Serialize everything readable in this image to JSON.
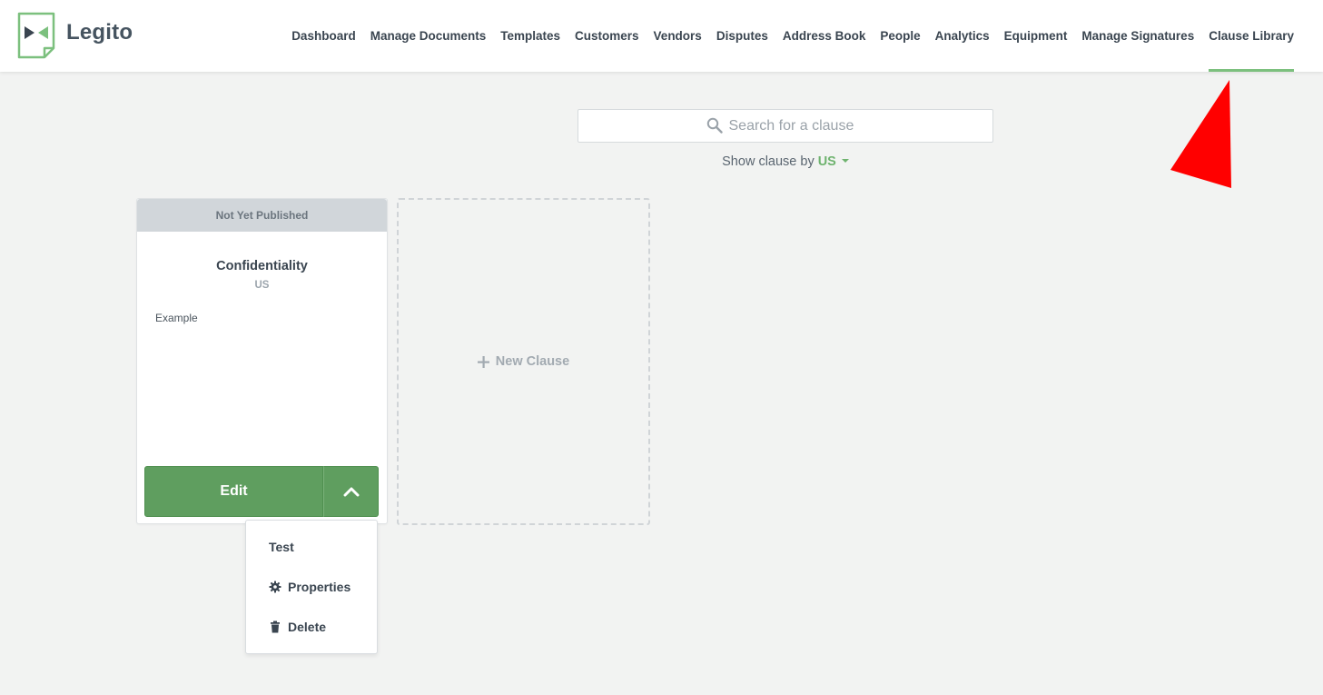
{
  "app": {
    "brand": "Legito",
    "logo_icon": "legito-logo-icon",
    "accent_color": "#7cc07e"
  },
  "nav": {
    "items": [
      {
        "label": "Dashboard"
      },
      {
        "label": "Manage Documents"
      },
      {
        "label": "Templates"
      },
      {
        "label": "Customers"
      },
      {
        "label": "Vendors"
      },
      {
        "label": "Disputes"
      },
      {
        "label": "Address Book"
      },
      {
        "label": "People"
      },
      {
        "label": "Analytics"
      },
      {
        "label": "Equipment"
      },
      {
        "label": "Manage Signatures"
      },
      {
        "label": "Clause Library"
      }
    ],
    "active": "Clause Library"
  },
  "search": {
    "placeholder": "Search for a clause",
    "value": "",
    "icon": "search-icon"
  },
  "filter": {
    "label": "Show clause by",
    "value": "US"
  },
  "clauses": [
    {
      "status": "Not Yet Published",
      "title": "Confidentiality",
      "region": "US",
      "excerpt": "Example",
      "edit_label": "Edit",
      "toggle_icon": "chevron-up-icon",
      "menu": [
        {
          "label": "Test",
          "icon": ""
        },
        {
          "label": "Properties",
          "icon": "gear-icon"
        },
        {
          "label": "Delete",
          "icon": "trash-icon"
        }
      ]
    }
  ],
  "new_clause": {
    "label": "New Clause",
    "icon": "plus-icon"
  },
  "annotation": {
    "icon": "red-arrow-icon",
    "color": "#ff0000"
  }
}
